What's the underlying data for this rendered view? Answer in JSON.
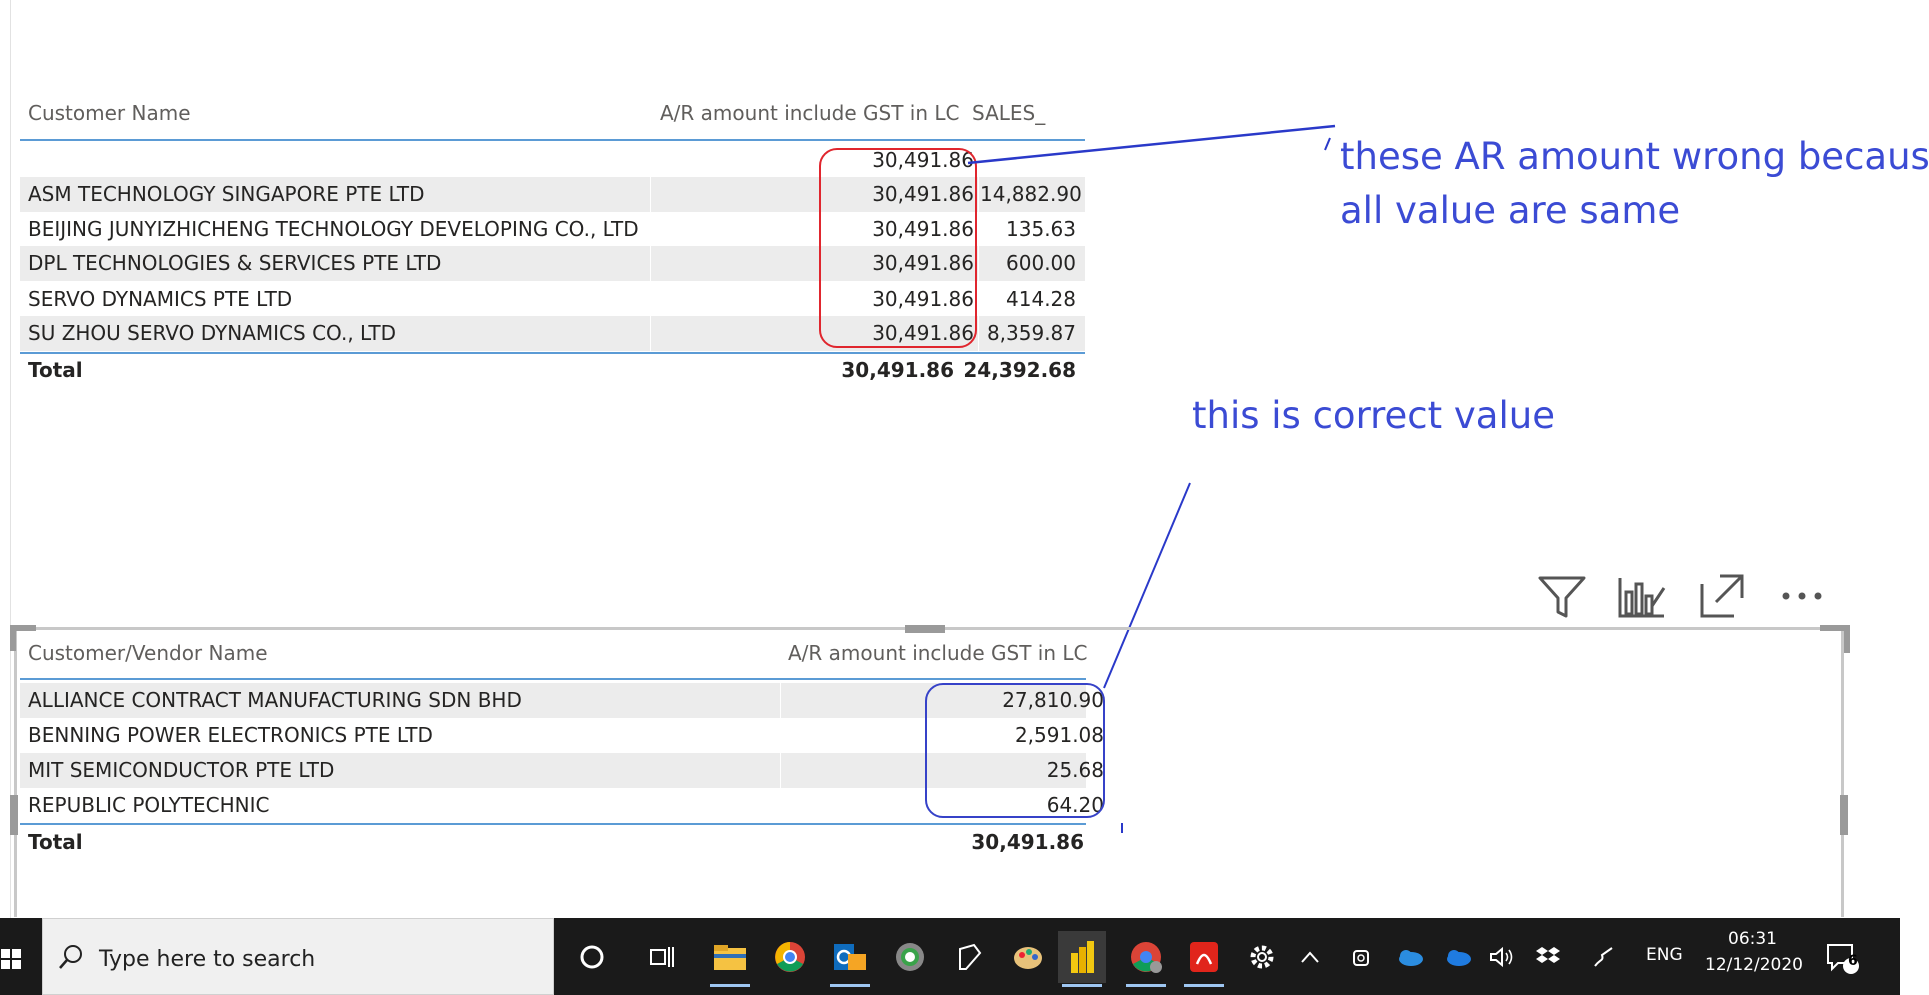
{
  "table1": {
    "headers": [
      "Customer Name",
      "A/R amount include GST in LC",
      "SALES_"
    ],
    "rows": [
      {
        "name": "",
        "ar": "30,491.86",
        "sales": ""
      },
      {
        "name": "ASM TECHNOLOGY SINGAPORE PTE LTD",
        "ar": "30,491.86",
        "sales": "14,882.90"
      },
      {
        "name": "BEIJING JUNYIZHICHENG TECHNOLOGY DEVELOPING CO., LTD",
        "ar": "30,491.86",
        "sales": "135.63"
      },
      {
        "name": "DPL TECHNOLOGIES & SERVICES PTE LTD",
        "ar": "30,491.86",
        "sales": "600.00"
      },
      {
        "name": "SERVO DYNAMICS PTE LTD",
        "ar": "30,491.86",
        "sales": "414.28"
      },
      {
        "name": "SU ZHOU SERVO DYNAMICS CO., LTD",
        "ar": "30,491.86",
        "sales": "8,359.87"
      }
    ],
    "total": {
      "label": "Total",
      "ar": "30,491.86",
      "sales": "24,392.68"
    }
  },
  "table2": {
    "headers": [
      "Customer/Vendor Name",
      "A/R amount include GST in LC"
    ],
    "rows": [
      {
        "name": "ALLIANCE CONTRACT MANUFACTURING SDN BHD",
        "ar": "27,810.90"
      },
      {
        "name": "BENNING POWER ELECTRONICS PTE LTD",
        "ar": "2,591.08"
      },
      {
        "name": "MIT SEMICONDUCTOR PTE LTD",
        "ar": "25.68"
      },
      {
        "name": "REPUBLIC POLYTECHNIC",
        "ar": "64.20"
      }
    ],
    "total": {
      "label": "Total",
      "ar": "30,491.86"
    }
  },
  "annotations": {
    "wrong_line1": "these AR amount wrong because",
    "wrong_line2": "all value are same",
    "correct": "this is correct value"
  },
  "visual_header_icons": [
    "filter-icon",
    "focus-mode-chart-icon",
    "expand-icon",
    "more-options-icon"
  ],
  "taskbar": {
    "search_placeholder": "Type here to search",
    "language": "ENG",
    "time": "06:31",
    "date": "12/12/2020",
    "notification_count": "6"
  },
  "colors": {
    "annotation_blue": "#3b4bd4",
    "annotation_red": "#e0262e",
    "accent_line": "#5b9bd5"
  }
}
